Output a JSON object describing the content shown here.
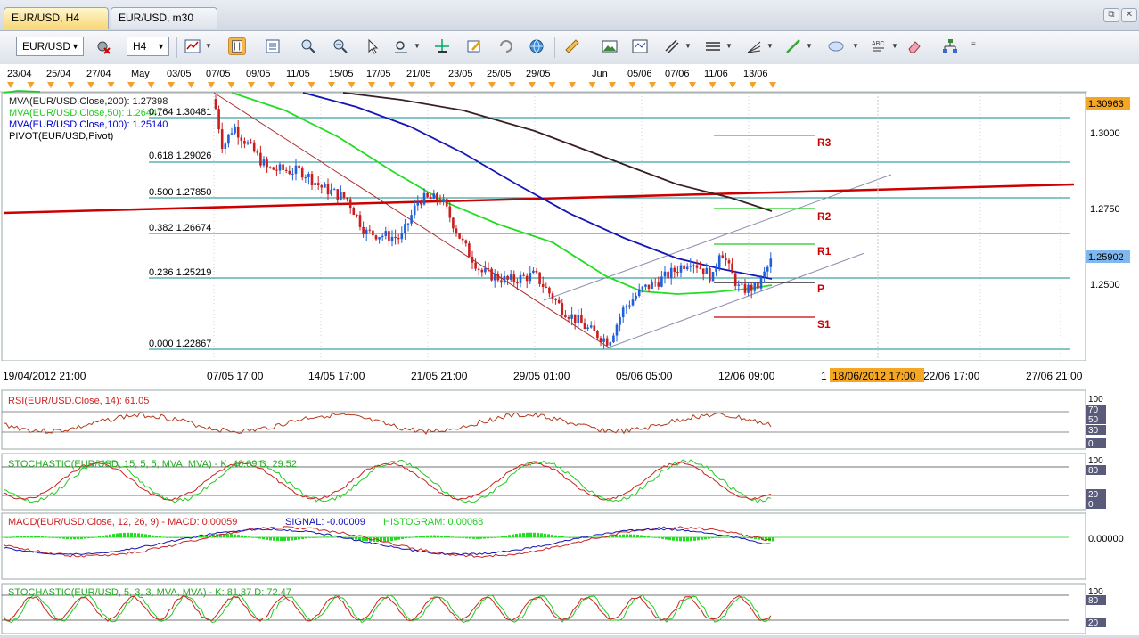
{
  "tabs": [
    {
      "label": "EUR/USD, H4",
      "active": true
    },
    {
      "label": "EUR/USD, m30",
      "active": false
    }
  ],
  "window_controls": {
    "restore": "⧉",
    "close": "✕"
  },
  "toolbar": {
    "symbol": "EUR/USD",
    "timeframe": "H4"
  },
  "date_ruler": [
    "23/04",
    "25/04",
    "27/04",
    "May",
    "03/05",
    "07/05",
    "09/05",
    "11/05",
    "15/05",
    "17/05",
    "21/05",
    "23/05",
    "25/05",
    "29/05",
    "Jun",
    "05/06",
    "07/06",
    "11/06",
    "13/06"
  ],
  "time_axis": [
    "19/04/2012 21:00",
    "07/05 17:00",
    "14/05 17:00",
    "21/05 21:00",
    "29/05 01:00",
    "05/06 05:00",
    "12/06 09:00",
    "22/06 17:00",
    "27/06 21:00"
  ],
  "time_axis_partial": "1",
  "time_cursor": "18/06/2012 17:00",
  "price_axis": [
    "1.3000",
    "1.2750",
    "1.2500"
  ],
  "price_markers": {
    "top": "1.30963",
    "current": "1.25902"
  },
  "legend": [
    {
      "text": "MVA(EUR/USD.Close,200): 1.27398",
      "color": "#222222"
    },
    {
      "text": "MVA(EUR/USD.Close,50): 1.26441",
      "color": "#22cc22"
    },
    {
      "text": "MVA(EUR/USD.Close,100): 1.25140",
      "color": "#0000cc"
    },
    {
      "text": "PIVOT(EUR/USD,Pivot)",
      "color": "#000000"
    }
  ],
  "fib_labels": [
    {
      "text": "0.764  1.30481"
    },
    {
      "text": "0.618  1.29026"
    },
    {
      "text": "0.500  1.27850"
    },
    {
      "text": "0.382  1.26674"
    },
    {
      "text": "0.236  1.25219"
    },
    {
      "text": "0.000  1.22867"
    }
  ],
  "pivot_labels": [
    "R3",
    "R2",
    "R1",
    "P",
    "S1"
  ],
  "panels": {
    "rsi": {
      "title": "RSI(EUR/USD.Close, 14): 61.05",
      "axis": [
        "100",
        "70",
        "50",
        "30",
        "0"
      ]
    },
    "stoch1": {
      "title": "STOCHASTIC(EUR/USD, 15, 5, 5, MVA, MVA)  -   K: 40.09   D: 29.52",
      "axis": [
        "100",
        "80",
        "20",
        "0"
      ]
    },
    "macd": {
      "title_main": "MACD(EUR/USD.Close, 12, 26, 9)  -  MACD: 0.00059",
      "title_signal": "SIGNAL: -0.00009",
      "title_hist": "HISTOGRAM: 0.00068",
      "axis": [
        "0.00000"
      ]
    },
    "stoch2": {
      "title": "STOCHASTIC(EUR/USD, 5, 3, 3, MVA, MVA)  -   K: 81.87   D: 72.47",
      "axis": [
        "100",
        "80",
        "20"
      ]
    }
  },
  "colors": {
    "bull_candle": "#1f5fd8",
    "bear_candle": "#c81e1e",
    "ma50": "#22dd22",
    "ma100": "#1515b8",
    "ma200": "#3a1f24",
    "pivot_red": "#cc0000",
    "fib": "#0e8c8c",
    "channel": "#8c8fb0",
    "accent": "#f5a623"
  }
}
